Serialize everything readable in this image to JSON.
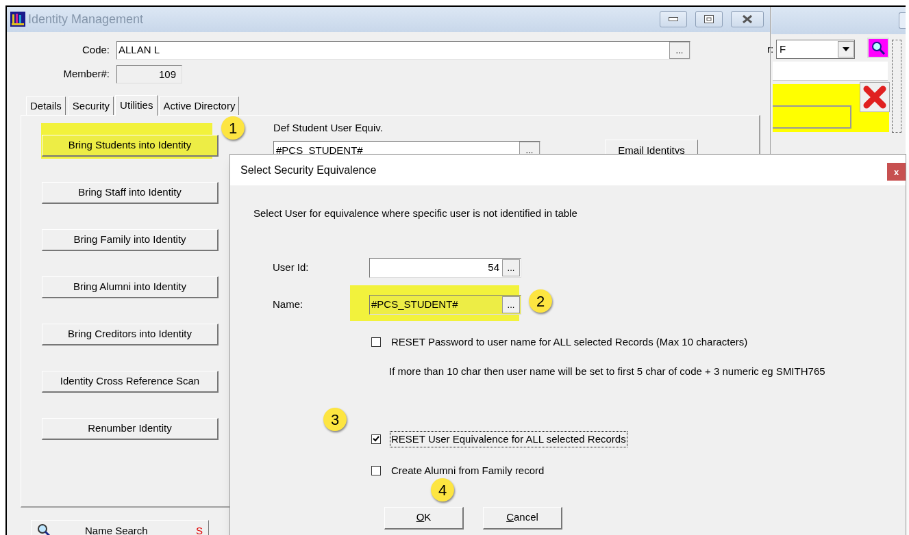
{
  "main_window": {
    "title": "Identity Management",
    "code": {
      "label": "Code:",
      "value": "ALLAN L",
      "browse": "..."
    },
    "member": {
      "label": "Member#:",
      "value": "109"
    },
    "tabs": [
      {
        "label": "Details",
        "selected": false
      },
      {
        "label": "Security",
        "selected": false
      },
      {
        "label": "Utilities",
        "selected": true
      },
      {
        "label": "Active Directory",
        "selected": false
      }
    ],
    "utility_buttons": [
      {
        "label": "Bring Students into Identity",
        "highlighted": true
      },
      {
        "label": "Bring Staff into Identity",
        "highlighted": false
      },
      {
        "label": "Bring Family into Identity",
        "highlighted": false
      },
      {
        "label": "Bring Alumni into Identity",
        "highlighted": false
      },
      {
        "label": "Bring Creditors into Identity",
        "highlighted": false
      },
      {
        "label": "Identity Cross Reference Scan",
        "highlighted": false
      },
      {
        "label": "Renumber Identity",
        "highlighted": false
      }
    ],
    "def_student": {
      "label": "Def Student User Equiv.",
      "value": "#PCS_STUDENT#",
      "browse": "..."
    },
    "email_button": "Email Identitys",
    "name_search": {
      "label": "Name Search",
      "shortcut": "S"
    }
  },
  "background_window": {
    "field_label": "r:",
    "dropdown_value": "F"
  },
  "dialog": {
    "title": "Select Security Equivalence",
    "close": "x",
    "instruction": "Select User for equivalence where specific user is not identified in table",
    "user_id": {
      "label": "User Id:",
      "value": "54",
      "browse": "...",
      "highlighted": false
    },
    "name": {
      "label": "Name:",
      "value": "#PCS_STUDENT#",
      "browse": "...",
      "highlighted": true
    },
    "options": [
      {
        "label": "RESET Password to user name for ALL selected  Records (Max 10 characters)",
        "checked": false,
        "focused": false,
        "note": "If more than 10 char then  user name will be set to  first 5 char of code + 3 numeric eg SMITH765"
      },
      {
        "label": "RESET User Equivalence for ALL selected  Records",
        "checked": true,
        "focused": true
      },
      {
        "label": "Create Alumni from Family record",
        "checked": false,
        "focused": false
      }
    ],
    "buttons": [
      "OK",
      "Cancel"
    ]
  },
  "callouts": [
    {
      "number": "1"
    },
    {
      "number": "2"
    },
    {
      "number": "3"
    },
    {
      "number": "4"
    }
  ]
}
